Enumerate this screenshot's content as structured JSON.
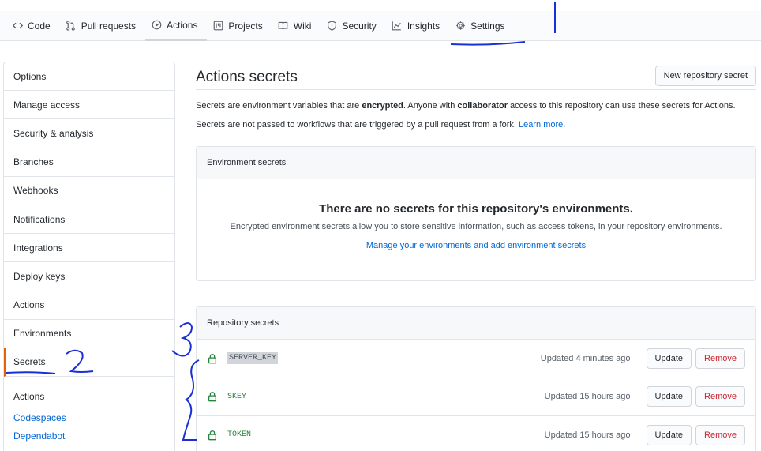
{
  "nav": {
    "tabs": [
      {
        "label": "Code",
        "icon": "code-icon"
      },
      {
        "label": "Pull requests",
        "icon": "pull-request-icon"
      },
      {
        "label": "Actions",
        "icon": "play-icon"
      },
      {
        "label": "Projects",
        "icon": "project-icon"
      },
      {
        "label": "Wiki",
        "icon": "book-icon"
      },
      {
        "label": "Security",
        "icon": "shield-icon"
      },
      {
        "label": "Insights",
        "icon": "graph-icon"
      },
      {
        "label": "Settings",
        "icon": "gear-icon"
      }
    ]
  },
  "sidebar": {
    "items": [
      "Options",
      "Manage access",
      "Security & analysis",
      "Branches",
      "Webhooks",
      "Notifications",
      "Integrations",
      "Deploy keys",
      "Actions",
      "Environments",
      "Secrets"
    ],
    "group_title": "Actions",
    "group_links": [
      "Codespaces",
      "Dependabot"
    ]
  },
  "main": {
    "title": "Actions secrets",
    "new_button": "New repository secret",
    "desc1_a": "Secrets are environment variables that are ",
    "desc1_b": "encrypted",
    "desc1_c": ". Anyone with ",
    "desc1_d": "collaborator",
    "desc1_e": " access to this repository can use these secrets for Actions.",
    "desc2": "Secrets are not passed to workflows that are triggered by a pull request from a fork. ",
    "learn_more": "Learn more."
  },
  "environment": {
    "header": "Environment secrets",
    "blank_title": "There are no secrets for this repository's environments.",
    "blank_desc": "Encrypted environment secrets allow you to store sensitive information, such as access tokens, in your repository environments.",
    "blank_link": "Manage your environments and add environment secrets"
  },
  "repository": {
    "header": "Repository secrets",
    "update_label": "Update",
    "remove_label": "Remove",
    "secrets": [
      {
        "name": "SERVER_KEY",
        "updated": "Updated 4 minutes ago"
      },
      {
        "name": "SKEY",
        "updated": "Updated 15 hours ago"
      },
      {
        "name": "TOKEN",
        "updated": "Updated 15 hours ago"
      }
    ]
  },
  "colors": {
    "accent_orange": "#e36209",
    "link_blue": "#0366d6",
    "secret_green": "#22863a",
    "remove_red": "#cb2431",
    "annotation_ink": "#1a2fd6"
  }
}
